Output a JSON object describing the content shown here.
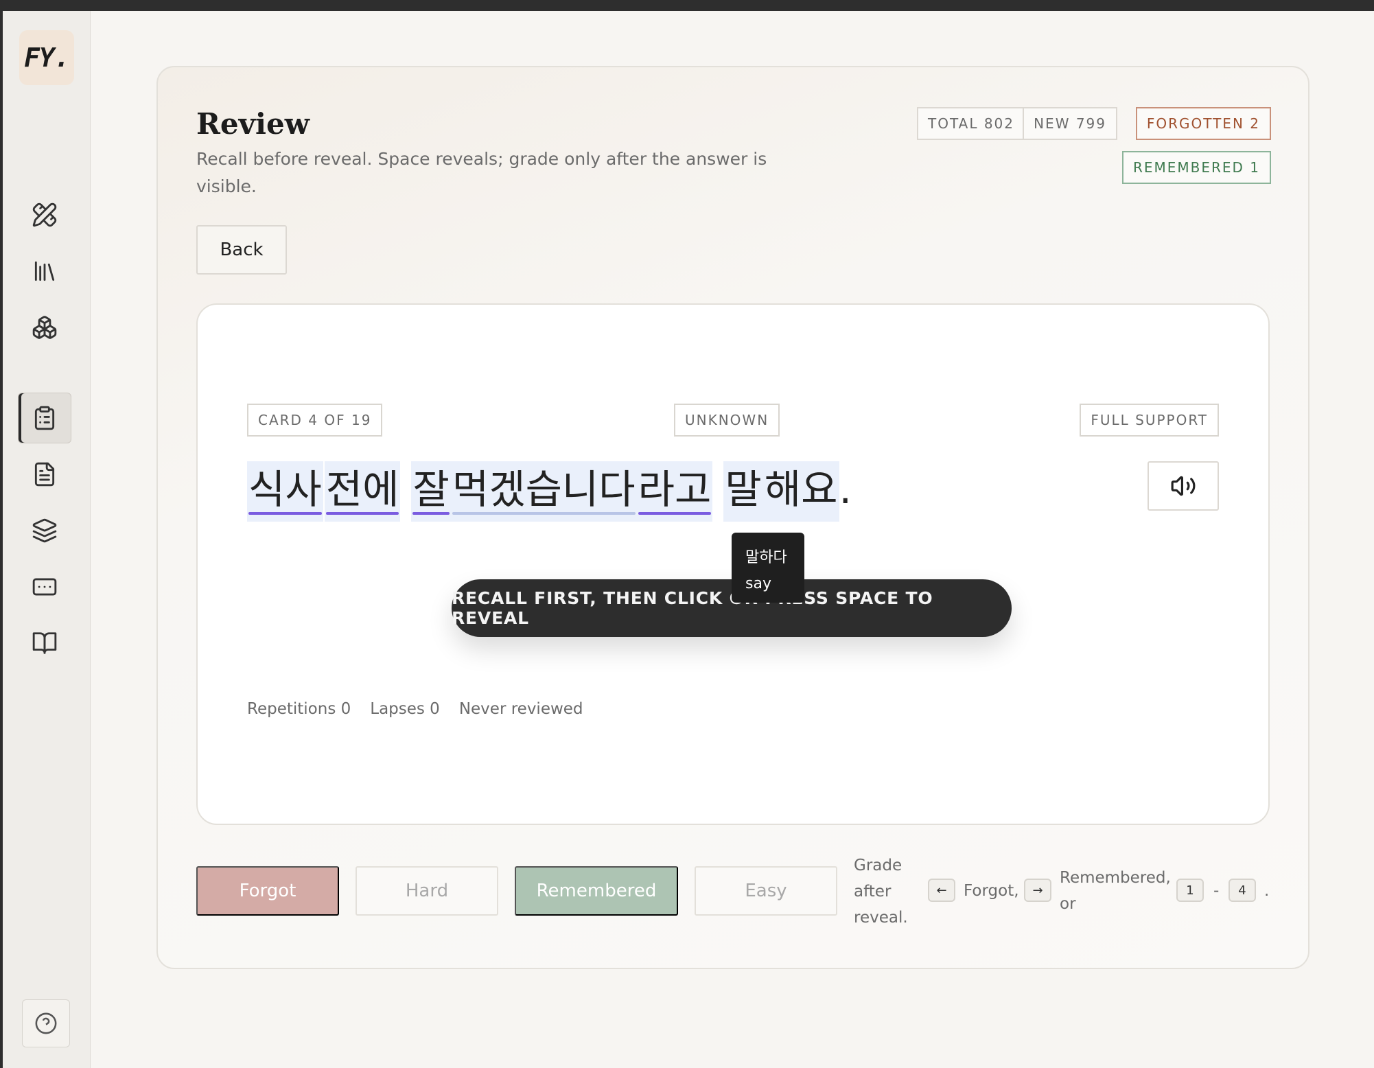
{
  "app": {
    "logo_text": "FY.",
    "nav": [
      {
        "icon": "pencil-ruler-icon",
        "active": false
      },
      {
        "icon": "library-icon",
        "active": false
      },
      {
        "icon": "boxes-icon",
        "active": false
      },
      {
        "icon": "clipboard-list-icon",
        "active": true
      },
      {
        "icon": "file-text-icon",
        "active": false
      },
      {
        "icon": "layers-icon",
        "active": false
      },
      {
        "icon": "keyboard-icon",
        "active": false
      },
      {
        "icon": "book-open-icon",
        "active": false
      }
    ],
    "help_icon": "help-circle-icon"
  },
  "review": {
    "title": "Review",
    "subtitle": "Recall before reveal. Space reveals; grade only after the answer is visible.",
    "stats": {
      "total": "TOTAL 802",
      "new": "NEW 799",
      "forgotten": "FORGOTTEN 2",
      "remembered": "REMEMBERED 1"
    },
    "back_label": "Back"
  },
  "card": {
    "position": "CARD 4 OF 19",
    "status": "UNKNOWN",
    "support": "FULL SUPPORT",
    "tokens": [
      "식사",
      "전에",
      "잘",
      "먹겠습니다",
      "라고",
      "말",
      "해요"
    ],
    "period": ".",
    "tooltip": {
      "word": "말하다",
      "gloss": "say"
    },
    "reveal_label": "RECALL FIRST, THEN CLICK OR PRESS SPACE TO REVEAL",
    "meta": {
      "repetitions": "Repetitions 0",
      "lapses": "Lapses 0",
      "reviewed": "Never reviewed"
    }
  },
  "grades": {
    "forgot": "Forgot",
    "hard": "Hard",
    "remembered": "Remembered",
    "easy": "Easy",
    "hint_intro": "Grade after reveal.",
    "key_left": "←",
    "forgot_text": "Forgot,",
    "key_right": "→",
    "remembered_text": "Remembered, or",
    "key_1": "1",
    "dash": "-",
    "key_4": "4",
    "end": "."
  },
  "colors": {
    "forgot_bg": "#d4aba6",
    "remembered_bg": "#adc4b3",
    "underline": "#7a5ce0",
    "token_bg": "#eaf0fb",
    "forgotten_accent": "#a0512f",
    "remembered_accent": "#3f7a4f"
  }
}
